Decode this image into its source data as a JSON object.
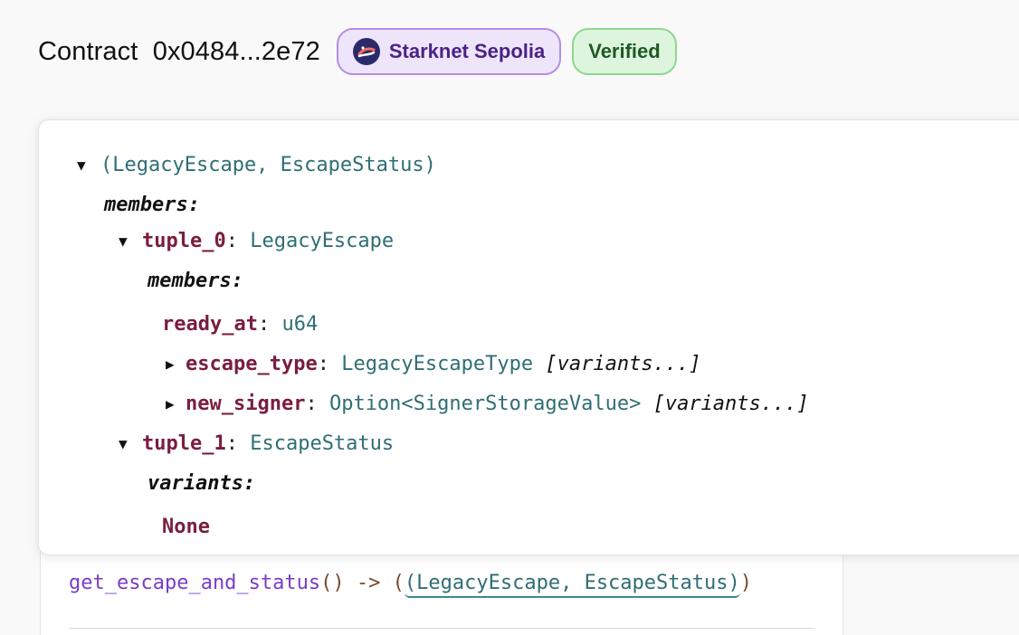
{
  "header": {
    "title": "Contract  0x0484...2e72",
    "network_badge": "Starknet Sepolia",
    "verified_badge": "Verified"
  },
  "signature": {
    "fn": "get_escape_and_status",
    "parens": "()",
    "arrow": " -> (",
    "return_type": "(LegacyEscape, EscapeStatus)",
    "close": ")"
  },
  "tree": {
    "root_type": "(LegacyEscape, EscapeStatus)",
    "members_label": "members:",
    "tuple_0": {
      "key": "tuple_0",
      "type": "LegacyEscape",
      "members_label": "members:",
      "fields": [
        {
          "key": "ready_at",
          "type": "u64",
          "extra": ""
        },
        {
          "key": "escape_type",
          "type": "LegacyEscapeType",
          "extra": "[variants...]"
        },
        {
          "key": "new_signer",
          "type": "Option<SignerStorageValue>",
          "extra": "[variants...]"
        }
      ]
    },
    "tuple_1": {
      "key": "tuple_1",
      "type": "EscapeStatus",
      "variants_label": "variants:",
      "variant": "None"
    }
  },
  "colors": {
    "key": "#7a1d40",
    "type": "#2f6e74",
    "function": "#7a3cc8",
    "network_badge_bg": "#efe5fa",
    "verified_badge_bg": "#dcf5dc"
  },
  "icons": [
    "starknet-logo-icon",
    "caret-down-icon",
    "caret-right-icon"
  ]
}
